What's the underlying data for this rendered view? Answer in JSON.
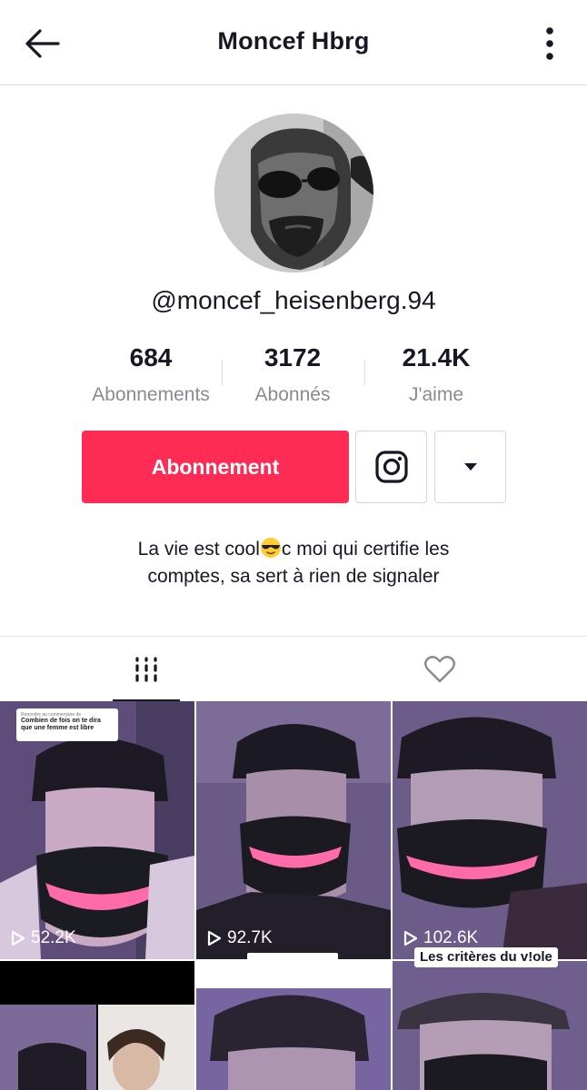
{
  "header": {
    "title": "Moncef Hbrg",
    "back_icon": "arrow-left-icon",
    "more_icon": "more-vertical-icon"
  },
  "profile": {
    "username": "@moncef_heisenberg.94",
    "stats": [
      {
        "value": "684",
        "label": "Abonnements"
      },
      {
        "value": "3172",
        "label": "Abonnés"
      },
      {
        "value": "21.4K",
        "label": "J'aime"
      }
    ],
    "follow_label": "Abonnement",
    "instagram_icon": "instagram-icon",
    "dropdown_icon": "caret-down-icon",
    "bio_line1_a": "La vie est cool",
    "bio_line1_b": "c moi qui certifie les",
    "bio_line2": "comptes, sa sert à rien de signaler",
    "bio_emoji": "sunglasses-emoji"
  },
  "tabs": [
    {
      "name": "videos",
      "icon": "grid-icon",
      "active": true
    },
    {
      "name": "liked",
      "icon": "heart-outline-icon",
      "active": false
    }
  ],
  "videos": [
    {
      "views": "52.2K",
      "caption_small": "Répondre au commentaire de",
      "caption": "Combien de fois on te dira que une femme est libre"
    },
    {
      "views": "92.7K"
    },
    {
      "views": "102.6K",
      "overlay_text": "Les critères du v!ole"
    },
    {},
    {},
    {}
  ],
  "colors": {
    "accent": "#fe2c55",
    "text": "#161823",
    "muted": "#8a8b91",
    "thumb_purple": "#6d5a8c"
  }
}
